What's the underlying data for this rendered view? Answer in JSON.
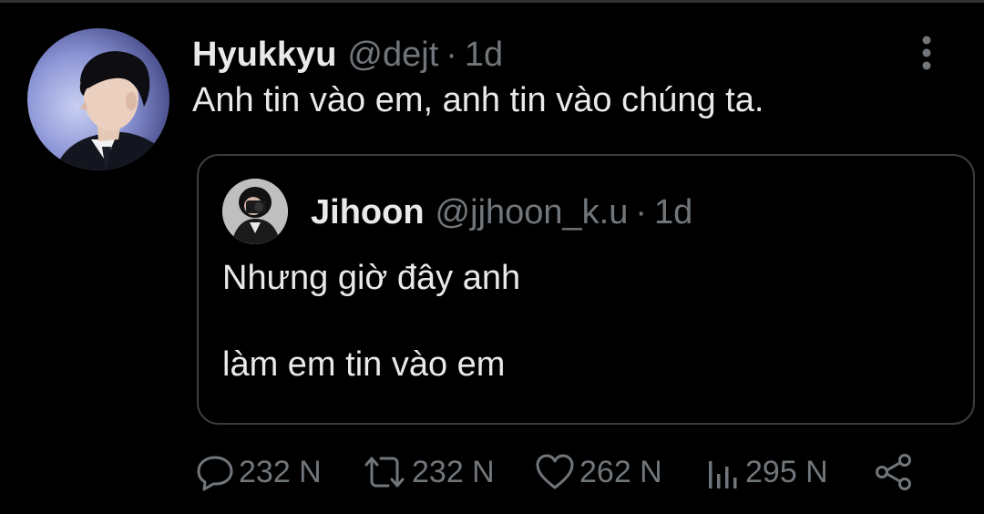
{
  "tweet": {
    "display_name": "Hyukkyu",
    "handle": "@dejt",
    "separator": "·",
    "time": "1d",
    "text": "Anh tin vào em, anh tin vào chúng ta.",
    "avatar_icon": "profile-photo"
  },
  "quote": {
    "display_name": "Jihoon",
    "handle": "@jjhoon_k.u",
    "separator": "·",
    "time": "1d",
    "line1": "Nhưng giờ đây anh",
    "line2": "làm em tin vào em",
    "avatar_icon": "profile-photo"
  },
  "actions": {
    "reply": {
      "icon": "reply-icon",
      "count": "232 N"
    },
    "retweet": {
      "icon": "retweet-icon",
      "count": "232 N"
    },
    "like": {
      "icon": "heart-icon",
      "count": "262 N"
    },
    "views": {
      "icon": "views-icon",
      "count": "295 N"
    },
    "share": {
      "icon": "share-icon"
    }
  },
  "colors": {
    "background": "#000000",
    "text_primary": "#e7e9ea",
    "text_secondary": "#71767b",
    "border": "#3a3d41"
  }
}
